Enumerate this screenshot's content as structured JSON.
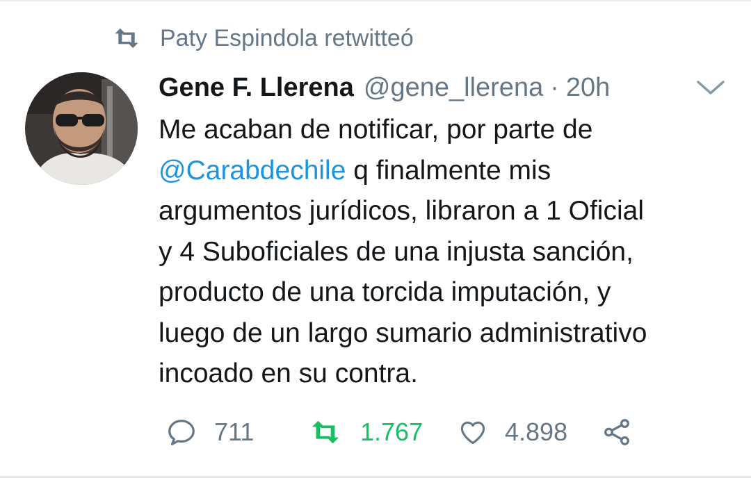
{
  "retweet_context": {
    "text": "Paty Espindola retwitteó",
    "icon": "retweet-icon"
  },
  "tweet": {
    "author_name": "Gene F. Llerena",
    "handle": "@gene_llerena",
    "separator": "·",
    "time": "20h",
    "body": {
      "line1": "Me acaban de notificar, por parte de",
      "mention": "@Carabdechile",
      "line2_rest": " q finalmente mis",
      "line3": "argumentos jurídicos, libraron a 1 Oficial",
      "line4": "y 4 Suboficiales de una injusta sanción,",
      "line5": "producto de una torcida imputación, y",
      "line6": "luego de un largo sumario administrativo",
      "line7": "incoado en su contra."
    }
  },
  "actions": {
    "replies": "711",
    "retweets": "1.767",
    "likes": "4.898"
  },
  "icons": [
    "retweet-icon",
    "chevron-down-icon",
    "reply-icon",
    "retweet-icon",
    "heart-icon",
    "share-icon"
  ],
  "colors": {
    "text": "#14171a",
    "secondary": "#657786",
    "link": "#1b95e0",
    "retweeted": "#17bf63"
  }
}
